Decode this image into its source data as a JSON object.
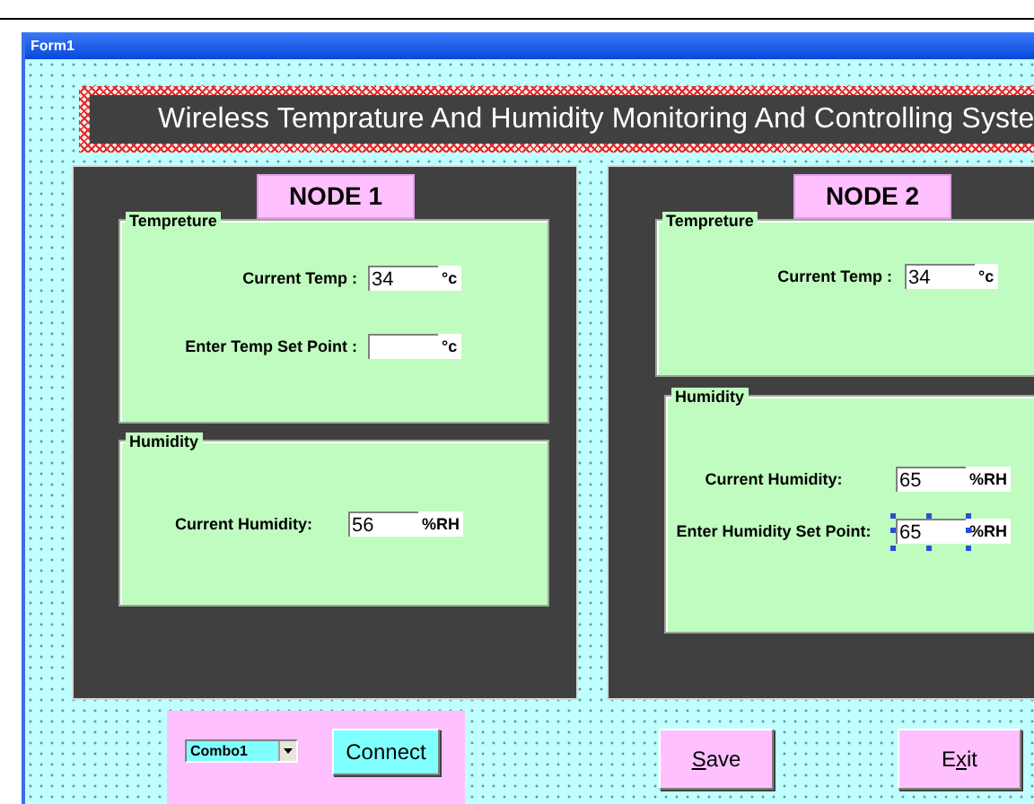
{
  "window": {
    "title": "Form1"
  },
  "banner": {
    "title": "Wireless Temprature And Humidity Monitoring And Controlling Syste"
  },
  "nodes": [
    {
      "title": "NODE 1",
      "frames": [
        {
          "legend": "Tempreture",
          "fields": [
            {
              "label": "Current Temp :",
              "value": "34",
              "unit": "°c",
              "selected": false
            },
            {
              "label": "Enter Temp Set Point :",
              "unit": "°c",
              "selected": false
            }
          ]
        },
        {
          "legend": "Humidity",
          "fields": [
            {
              "label": "Current Humidity:",
              "value": "56",
              "unit": "%RH",
              "selected": false
            }
          ]
        }
      ]
    },
    {
      "title": "NODE 2",
      "frames": [
        {
          "legend": "Tempreture",
          "fields": [
            {
              "label": "Current Temp :",
              "value": "34",
              "unit": "°c",
              "selected": false
            }
          ]
        },
        {
          "legend": "Humidity",
          "fields": [
            {
              "label": "Current Humidity:",
              "value": "65",
              "unit": "%RH",
              "selected": false
            },
            {
              "label": "Enter Humidity Set Point:",
              "value": "65",
              "unit": "%RH",
              "selected": true
            }
          ]
        }
      ]
    }
  ],
  "connection": {
    "combo": {
      "value": "Combo1"
    },
    "button": {
      "label": "Connect"
    }
  },
  "buttons": [
    {
      "label": [
        {
          "text": "S",
          "underlined": true
        },
        {
          "text": "ave",
          "underlined": false
        }
      ]
    },
    {
      "label": [
        {
          "text": "E",
          "underlined": false
        },
        {
          "text": "x",
          "underlined": true
        },
        {
          "text": "it",
          "underlined": false
        }
      ]
    }
  ]
}
